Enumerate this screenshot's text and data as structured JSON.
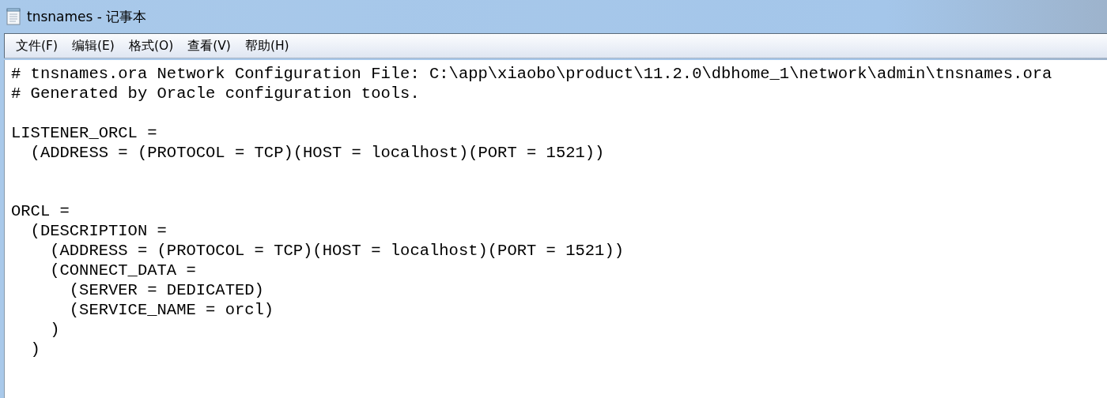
{
  "window": {
    "title": "tnsnames - 记事本"
  },
  "menu": [
    {
      "label": "文件(F)"
    },
    {
      "label": "编辑(E)"
    },
    {
      "label": "格式(O)"
    },
    {
      "label": "查看(V)"
    },
    {
      "label": "帮助(H)"
    }
  ],
  "editor": {
    "text": "# tnsnames.ora Network Configuration File: C:\\app\\xiaobo\\product\\11.2.0\\dbhome_1\\network\\admin\\tnsnames.ora\n# Generated by Oracle configuration tools.\n\nLISTENER_ORCL =\n  (ADDRESS = (PROTOCOL = TCP)(HOST = localhost)(PORT = 1521))\n\n\nORCL =\n  (DESCRIPTION =\n    (ADDRESS = (PROTOCOL = TCP)(HOST = localhost)(PORT = 1521))\n    (CONNECT_DATA =\n      (SERVER = DEDICATED)\n      (SERVICE_NAME = orcl)\n    )\n  )"
  }
}
